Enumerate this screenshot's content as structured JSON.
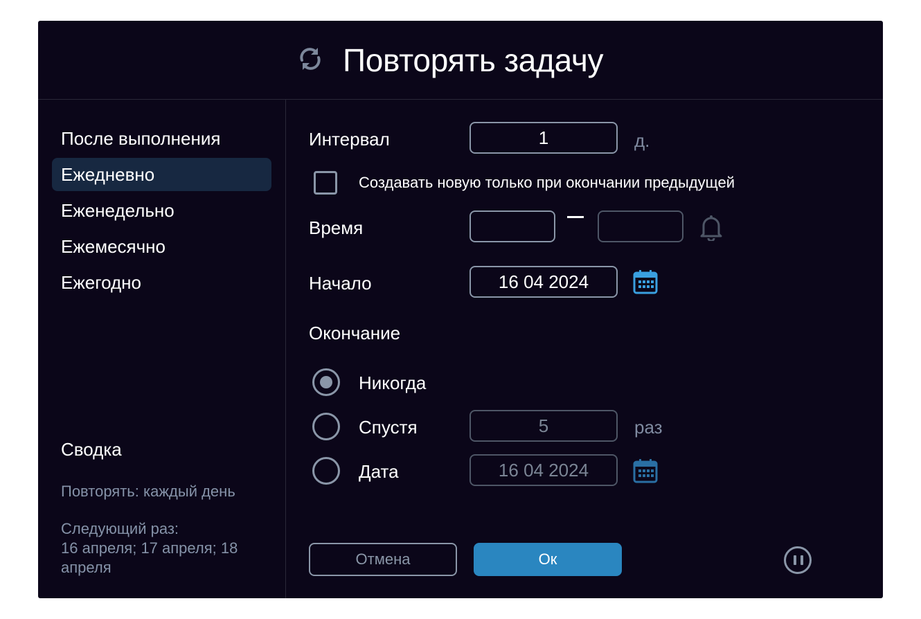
{
  "dialog": {
    "title": "Повторять задачу",
    "icon": "refresh-icon"
  },
  "sidebar": {
    "items": [
      {
        "label": "После выполнения",
        "active": false
      },
      {
        "label": "Ежедневно",
        "active": true
      },
      {
        "label": "Еженедельно",
        "active": false
      },
      {
        "label": "Ежемесячно",
        "active": false
      },
      {
        "label": "Ежегодно",
        "active": false
      }
    ],
    "summary": {
      "title": "Сводка",
      "repeat": "Повторять: каждый день",
      "next_line1": "Следующий раз:",
      "next_line2": "16 апреля; 17 апреля; 18",
      "next_line3": "апреля"
    }
  },
  "form": {
    "interval_label": "Интервал",
    "interval_value": "1",
    "interval_unit": "д.",
    "create_only_after_label": "Создавать новую только при окончании предыдущей",
    "create_only_after_checked": false,
    "time_label": "Время",
    "time_from": "",
    "time_to": "",
    "start_label": "Начало",
    "start_date": "16 04 2024",
    "end_label": "Окончание",
    "end_options": {
      "never": {
        "label": "Никогда",
        "selected": true
      },
      "after": {
        "label": "Спустя",
        "value": "5",
        "unit": "раз",
        "selected": false
      },
      "date": {
        "label": "Дата",
        "value": "16 04 2024",
        "selected": false
      }
    }
  },
  "buttons": {
    "cancel": "Отмена",
    "ok": "Ок"
  },
  "colors": {
    "background": "#0b0619",
    "accent": "#2a86c0",
    "calendar_active": "#3aa0e0",
    "muted": "#8592a8"
  }
}
